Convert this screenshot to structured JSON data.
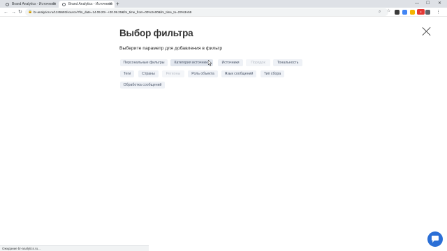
{
  "browser": {
    "tabs": [
      {
        "title": "Brand Analytics - Источники",
        "active": false
      },
      {
        "title": "Brand Analytics - Источники",
        "active": true
      }
    ],
    "url": "br-analytics.ru/1245693/source/?fm_date=14.09.20+-+20.09.20&fm_time_from=00%3A00&fm_time_to=23%3A59",
    "status_text": "Ожидание br-analytics.ru..."
  },
  "modal": {
    "title": "Выбор фильтра",
    "subtitle": "Выберите параметр для добавления в фильтр",
    "options": [
      {
        "label": "Персональные фильтры",
        "state": "enabled"
      },
      {
        "label": "Категория источника",
        "state": "hover"
      },
      {
        "label": "Источники",
        "state": "enabled"
      },
      {
        "label": "Порядок",
        "state": "disabled"
      },
      {
        "label": "Тональность",
        "state": "enabled"
      },
      {
        "label": "Теги",
        "state": "enabled"
      },
      {
        "label": "Страны",
        "state": "enabled"
      },
      {
        "label": "Регионы",
        "state": "disabled"
      },
      {
        "label": "Роль объекта",
        "state": "enabled"
      },
      {
        "label": "Язык сообщений",
        "state": "enabled"
      },
      {
        "label": "Тип сбора",
        "state": "enabled"
      },
      {
        "label": "Обработка сообщений",
        "state": "enabled"
      }
    ]
  },
  "colors": {
    "chip_bg": "#eef1f6",
    "chip_text": "#4a5568",
    "chat_button": "#2b6fd6",
    "profile_badge": "#e53935"
  },
  "icons": [
    "back-icon",
    "forward-icon",
    "reload-icon",
    "lock-icon",
    "zoom-icon",
    "star-icon",
    "extension-icon",
    "close-icon",
    "chat-icon",
    "cursor-icon"
  ]
}
